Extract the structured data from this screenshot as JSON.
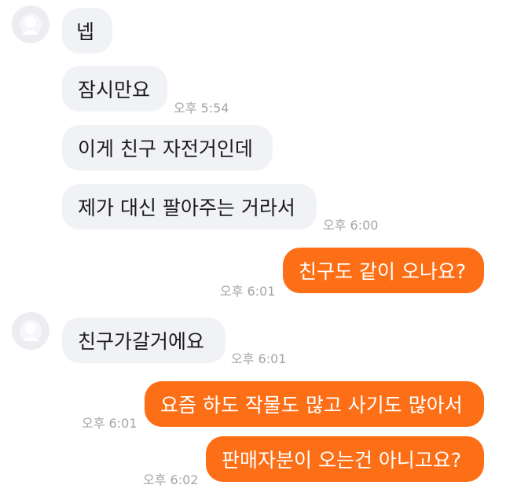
{
  "messages": [
    {
      "side": "in",
      "text": "넵"
    },
    {
      "side": "in",
      "text": "잠시만요",
      "time": "오후 5:54"
    },
    {
      "side": "in",
      "text": "이게 친구 자전거인데"
    },
    {
      "side": "in",
      "text": "제가 대신 팔아주는 거라서",
      "time": "오후 6:00"
    },
    {
      "side": "out",
      "text": "친구도 같이 오나요?",
      "time": "오후 6:01"
    },
    {
      "side": "in",
      "text": "친구가갈거에요",
      "time": "오후 6:01"
    },
    {
      "side": "out",
      "text": "요즘 하도 작물도 많고 사기도 많아서",
      "time": "오후 6:01"
    },
    {
      "side": "out",
      "text": "판매자분이 오는건 아니고요?",
      "time": "오후 6:02"
    }
  ],
  "colors": {
    "incoming_bubble": "#f1f2f6",
    "outgoing_bubble": "#fd6f17",
    "timestamp": "#a4a4a8",
    "avatar": "#ececf1"
  },
  "icons": {
    "avatar": "default-profile-avatar-icon"
  }
}
